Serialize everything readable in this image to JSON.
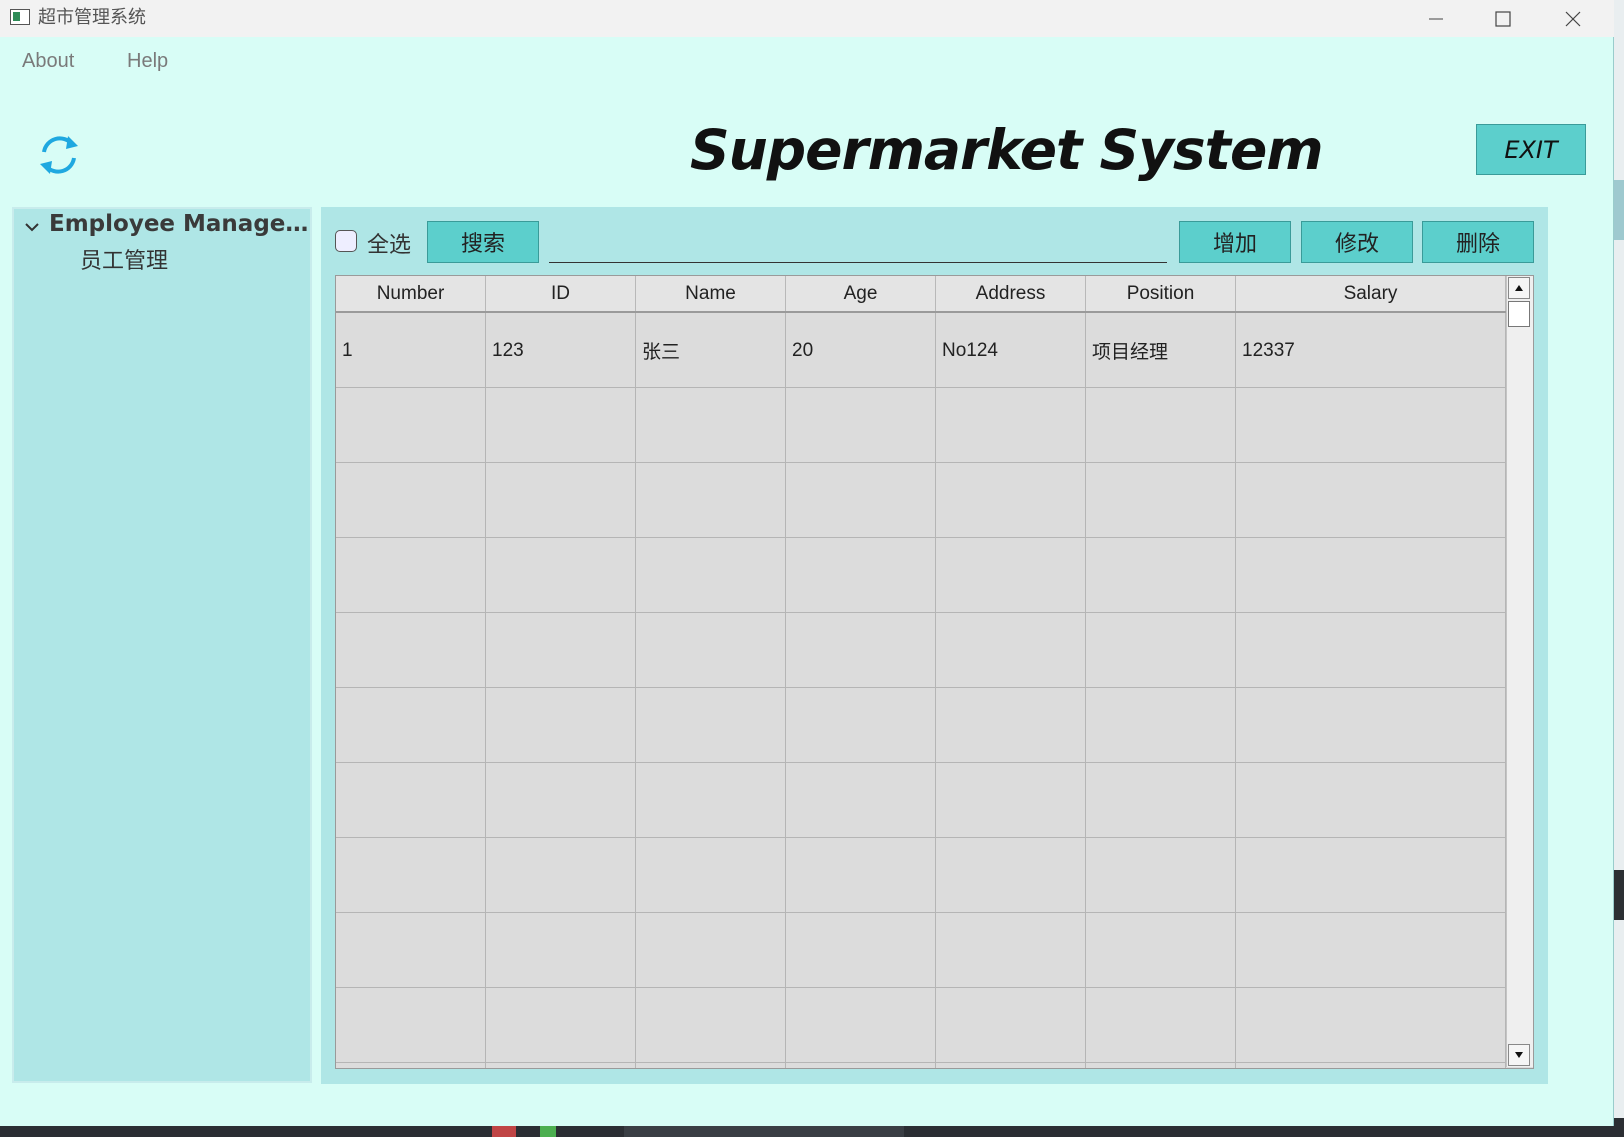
{
  "window": {
    "title": "超市管理系统",
    "controls": {
      "minimize": "minimize-icon",
      "maximize": "maximize-icon",
      "close": "close-icon"
    }
  },
  "menu": {
    "about": "About",
    "help": "Help"
  },
  "header": {
    "refresh_icon": "refresh-icon",
    "title": "Supermarket System",
    "exit_label": "EXIT"
  },
  "sidebar": {
    "root_label": "Employee Managem...",
    "child_label": "员工管理"
  },
  "toolbar": {
    "select_all_label": "全选",
    "search_label": "搜索",
    "search_value": "",
    "add_label": "增加",
    "edit_label": "修改",
    "delete_label": "删除"
  },
  "table": {
    "columns": [
      "Number",
      "ID",
      "Name",
      "Age",
      "Address",
      "Position",
      "Salary"
    ],
    "rows": [
      [
        "1",
        "123",
        "张三",
        "20",
        "No124",
        "项目经理",
        "12337"
      ],
      [
        "",
        "",
        "",
        "",
        "",
        "",
        ""
      ],
      [
        "",
        "",
        "",
        "",
        "",
        "",
        ""
      ],
      [
        "",
        "",
        "",
        "",
        "",
        "",
        ""
      ],
      [
        "",
        "",
        "",
        "",
        "",
        "",
        ""
      ],
      [
        "",
        "",
        "",
        "",
        "",
        "",
        ""
      ],
      [
        "",
        "",
        "",
        "",
        "",
        "",
        ""
      ],
      [
        "",
        "",
        "",
        "",
        "",
        "",
        ""
      ],
      [
        "",
        "",
        "",
        "",
        "",
        "",
        ""
      ],
      [
        "",
        "",
        "",
        "",
        "",
        "",
        ""
      ],
      [
        "",
        "",
        "",
        "",
        "",
        "",
        ""
      ]
    ]
  },
  "colors": {
    "window_bg": "#d8fdf6",
    "panel_bg": "#afe6e6",
    "button_bg": "#5ccfcc",
    "table_bg": "#dcdcdc"
  }
}
